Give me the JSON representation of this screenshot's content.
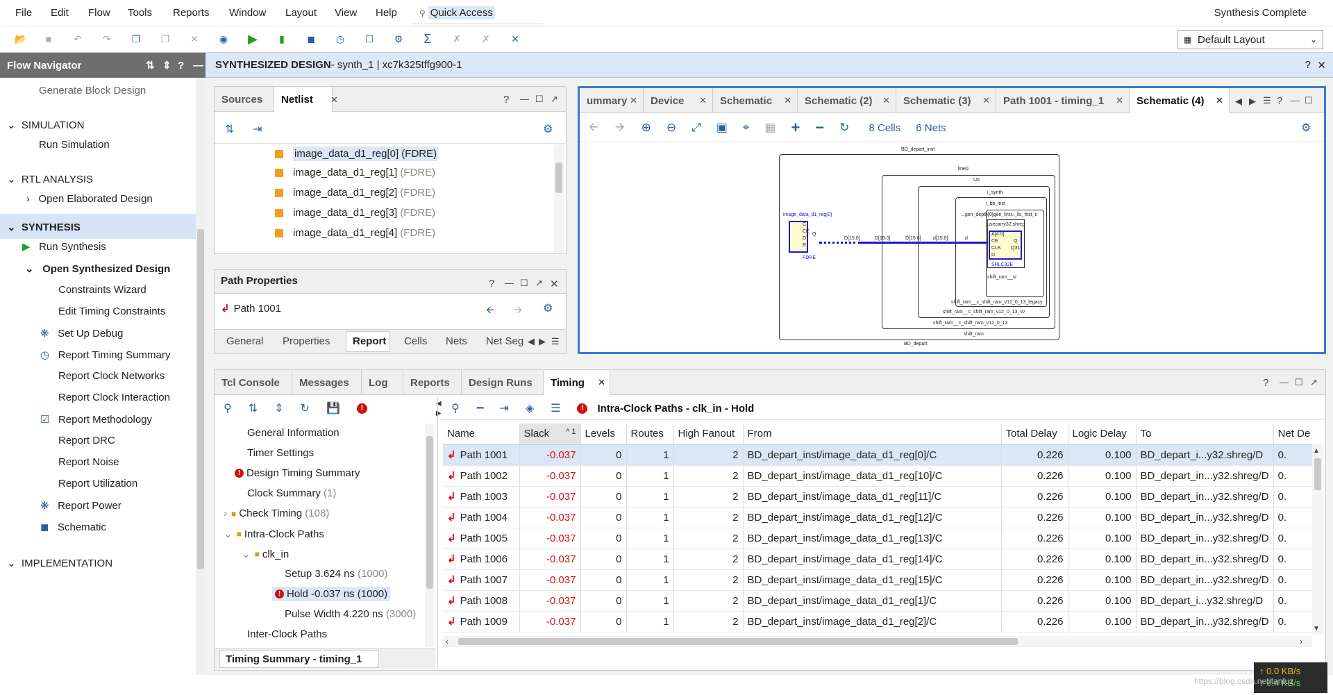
{
  "menu": [
    "File",
    "Edit",
    "Flow",
    "Tools",
    "Reports",
    "Window",
    "Layout",
    "View",
    "Help"
  ],
  "quick_access": "Quick Access",
  "status": "Synthesis Complete",
  "layout_select": "Default Layout",
  "flow_nav": {
    "title": "Flow Navigator",
    "generate_block": "Generate Block Design",
    "simulation": "SIMULATION",
    "run_sim": "Run Simulation",
    "rtl": "RTL ANALYSIS",
    "open_elab": "Open Elaborated Design",
    "synthesis": "SYNTHESIS",
    "run_synth": "Run Synthesis",
    "open_synth": "Open Synthesized Design",
    "items": [
      "Constraints Wizard",
      "Edit Timing Constraints",
      "Set Up Debug",
      "Report Timing Summary",
      "Report Clock Networks",
      "Report Clock Interaction",
      "Report Methodology",
      "Report DRC",
      "Report Noise",
      "Report Utilization",
      "Report Power",
      "Schematic"
    ],
    "implementation": "IMPLEMENTATION"
  },
  "header": {
    "title": "SYNTHESIZED DESIGN",
    "subtitle": " - synth_1 | xc7k325tffg900-1"
  },
  "netlist": {
    "tabs": [
      "Sources",
      "Netlist"
    ],
    "rows": [
      {
        "name": "image_data_d1_reg[0]",
        "type": "(FDRE)"
      },
      {
        "name": "image_data_d1_reg[1]",
        "type": "(FDRE)"
      },
      {
        "name": "image_data_d1_reg[2]",
        "type": "(FDRE)"
      },
      {
        "name": "image_data_d1_reg[3]",
        "type": "(FDRE)"
      },
      {
        "name": "image_data_d1_reg[4]",
        "type": "(FDRE)"
      }
    ]
  },
  "path_props": {
    "title": "Path Properties",
    "path": "Path 1001",
    "tabs": [
      "General",
      "Properties",
      "Report",
      "Cells",
      "Nets",
      "Net Seg"
    ]
  },
  "schematic": {
    "tabs": [
      "ummary",
      "Device",
      "Schematic",
      "Schematic (2)",
      "Schematic (3)",
      "Path 1001 - timing_1",
      "Schematic (4)"
    ],
    "cells": "8 Cells",
    "nets": "6 Nets",
    "labels": {
      "outer": "BD_depart_inst",
      "outer_bottom": "BD_depart",
      "line0": "line0",
      "u0": "U0",
      "i_synth": "i_synth",
      "i_bb": "i_bb_inst",
      "gen": "...gen_depth[0]gen_first.i_lls_first_c",
      "use": "usecarry32.shreg",
      "ff": "image_data_d1_reg[0]",
      "fdre": "FDRE",
      "srl": "SRLC32E",
      "shift_sr": "shift_ram__sr",
      "legacy": "shift_ram__c_shift_ram_v12_0_13_legacy",
      "vv": "shift_ram__c_shift_ram_v12_0_13_vv",
      "v13": "shift_ram__c_shift_ram_v12_0_13",
      "shift_ram": "shift_ram",
      "ff_pins": [
        "C",
        "CE",
        "D",
        "R"
      ],
      "ff_q": "Q",
      "srl_pins": [
        "A[4:0]",
        "CE",
        "CLK",
        "D"
      ],
      "srl_q": "Q",
      "srl_q31": "Q31",
      "w1": "D[15:0]",
      "w2": "D[15:0]",
      "w3": "D[15:0]",
      "w4": "d[15:0]",
      "w5": "d"
    }
  },
  "bottom_tabs": [
    "Tcl Console",
    "Messages",
    "Log",
    "Reports",
    "Design Runs",
    "Timing"
  ],
  "timing_tree": {
    "items": [
      {
        "t": "General Information",
        "c": ""
      },
      {
        "t": "Timer Settings",
        "c": ""
      },
      {
        "t": "Design Timing Summary",
        "c": ""
      },
      {
        "t": "Clock Summary",
        "c": "(1)"
      },
      {
        "t": "Check Timing",
        "c": "(108)"
      },
      {
        "t": "Intra-Clock Paths",
        "c": ""
      },
      {
        "t": "clk_in",
        "c": ""
      },
      {
        "t": "Setup 3.624 ns",
        "c": "(1000)"
      },
      {
        "t": "Hold -0.037 ns (1000)",
        "c": ""
      },
      {
        "t": "Pulse Width 4.220 ns",
        "c": "(3000)"
      },
      {
        "t": "Inter-Clock Paths",
        "c": ""
      }
    ],
    "footer_tab": "Timing Summary - timing_1"
  },
  "timing_table": {
    "title": "Intra-Clock Paths - clk_in - Hold",
    "sort_indicator": "1",
    "columns": [
      "Name",
      "Slack",
      "Levels",
      "Routes",
      "High Fanout",
      "From",
      "Total Delay",
      "Logic Delay",
      "To",
      "Net De"
    ],
    "rows": [
      [
        "Path 1001",
        "-0.037",
        "0",
        "1",
        "2",
        "BD_depart_inst/image_data_d1_reg[0]/C",
        "0.226",
        "0.100",
        "BD_depart_i...y32.shreg/D",
        "0."
      ],
      [
        "Path 1002",
        "-0.037",
        "0",
        "1",
        "2",
        "BD_depart_inst/image_data_d1_reg[10]/C",
        "0.226",
        "0.100",
        "BD_depart_in...y32.shreg/D",
        "0."
      ],
      [
        "Path 1003",
        "-0.037",
        "0",
        "1",
        "2",
        "BD_depart_inst/image_data_d1_reg[11]/C",
        "0.226",
        "0.100",
        "BD_depart_in...y32.shreg/D",
        "0."
      ],
      [
        "Path 1004",
        "-0.037",
        "0",
        "1",
        "2",
        "BD_depart_inst/image_data_d1_reg[12]/C",
        "0.226",
        "0.100",
        "BD_depart_in...y32.shreg/D",
        "0."
      ],
      [
        "Path 1005",
        "-0.037",
        "0",
        "1",
        "2",
        "BD_depart_inst/image_data_d1_reg[13]/C",
        "0.226",
        "0.100",
        "BD_depart_in...y32.shreg/D",
        "0."
      ],
      [
        "Path 1006",
        "-0.037",
        "0",
        "1",
        "2",
        "BD_depart_inst/image_data_d1_reg[14]/C",
        "0.226",
        "0.100",
        "BD_depart_in...y32.shreg/D",
        "0."
      ],
      [
        "Path 1007",
        "-0.037",
        "0",
        "1",
        "2",
        "BD_depart_inst/image_data_d1_reg[15]/C",
        "0.226",
        "0.100",
        "BD_depart_in...y32.shreg/D",
        "0."
      ],
      [
        "Path 1008",
        "-0.037",
        "0",
        "1",
        "2",
        "BD_depart_inst/image_data_d1_reg[1]/C",
        "0.226",
        "0.100",
        "BD_depart_i...y32.shreg/D",
        "0."
      ],
      [
        "Path 1009",
        "-0.037",
        "0",
        "1",
        "2",
        "BD_depart_inst/image_data_d1_reg[2]/C",
        "0.226",
        "0.100",
        "BD_depart_in...y32.shreg/D",
        "0."
      ]
    ]
  },
  "net_speed": {
    "up": "0.0 KB/s",
    "down": "0.4 KB/s"
  },
  "watermark": "https://blog.csdn.net/tanfuz"
}
